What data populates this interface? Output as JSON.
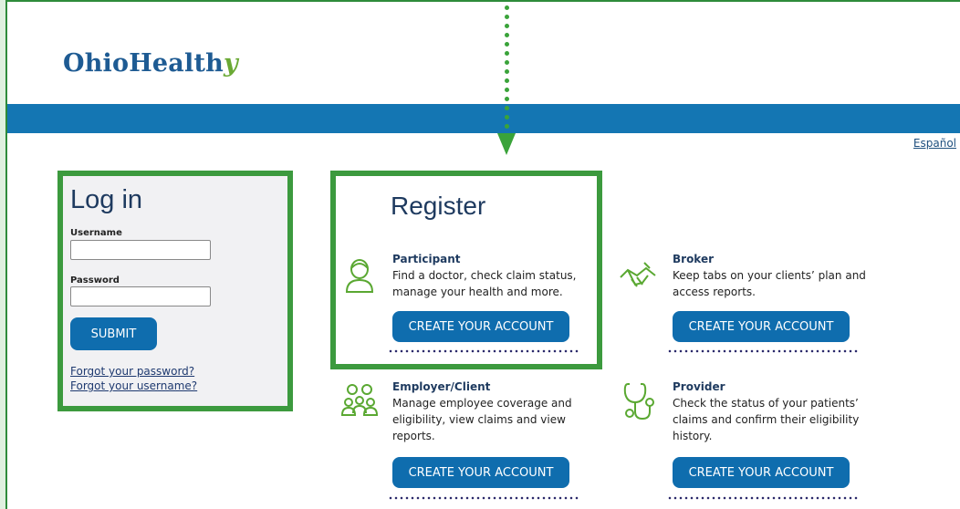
{
  "brand": {
    "main": "OhioHealth",
    "accent": "y",
    "color": "#1e5b93",
    "accent_color": "#6aa934"
  },
  "language_link": "Español",
  "login": {
    "title": "Log in",
    "username_label": "Username",
    "password_label": "Password",
    "submit": "SUBMIT",
    "forgot_password": "Forgot your password?",
    "forgot_username": "Forgot your username?"
  },
  "register": {
    "title": "Register",
    "cards": [
      {
        "title": "Participant",
        "desc_lines": [
          "Find a doctor, check claim status,",
          "manage your health and more."
        ],
        "button": "CREATE YOUR ACCOUNT",
        "icon": "person-icon"
      },
      {
        "title": "Broker",
        "desc_lines": [
          "Keep tabs on your clients’ plan and",
          "access reports."
        ],
        "button": "CREATE YOUR ACCOUNT",
        "icon": "handshake-icon"
      },
      {
        "title": "Employer/Client",
        "desc_lines": [
          "Manage employee coverage and",
          "eligibility, view claims and view",
          "reports."
        ],
        "button": "CREATE YOUR ACCOUNT",
        "icon": "group-icon"
      },
      {
        "title": "Provider",
        "desc_lines": [
          "Check the status of your patients’",
          "claims and confirm their eligibility",
          "history."
        ],
        "button": "CREATE YOUR ACCOUNT",
        "icon": "stethoscope-icon"
      }
    ]
  },
  "colors": {
    "primary": "#0f6dae",
    "highlight": "#3c9a3e",
    "bar": "#1476b3"
  }
}
